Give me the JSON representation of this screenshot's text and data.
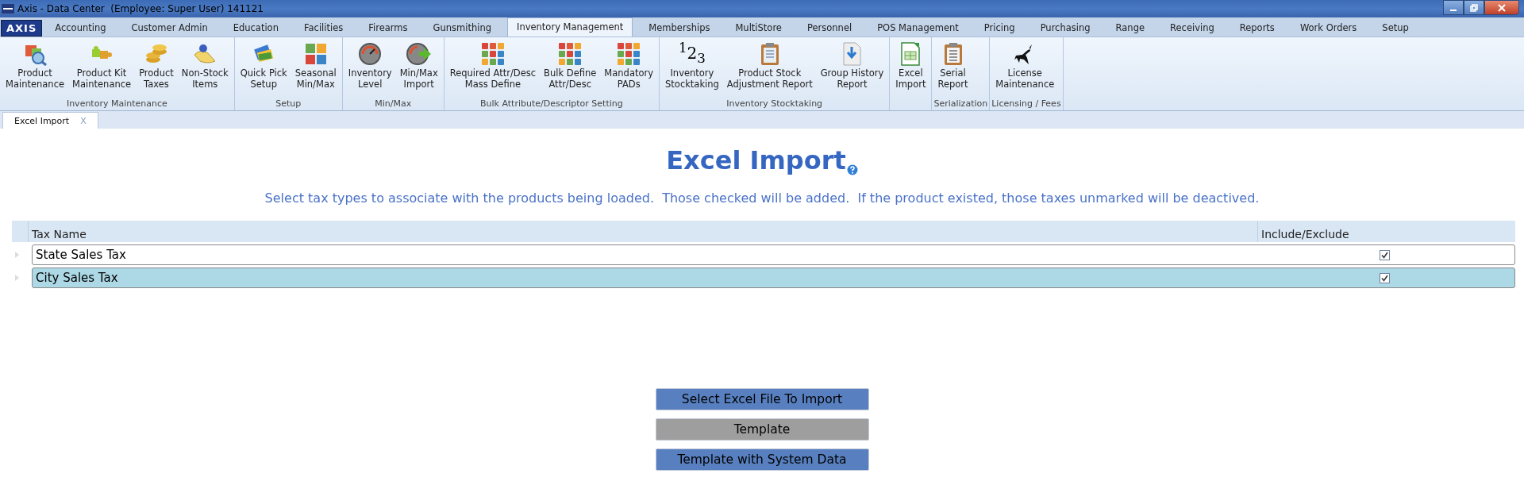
{
  "window": {
    "title": "Axis - Data Center  (Employee: Super User) 141121"
  },
  "menu_tabs": [
    {
      "label": "AXIS",
      "kind": "logo",
      "selected": false
    },
    {
      "label": "Accounting",
      "selected": false
    },
    {
      "label": "Customer Admin",
      "selected": false
    },
    {
      "label": "Education",
      "selected": false
    },
    {
      "label": "Facilities",
      "selected": false
    },
    {
      "label": "Firearms",
      "selected": false
    },
    {
      "label": "Gunsmithing",
      "selected": false
    },
    {
      "label": "Inventory Management",
      "selected": true
    },
    {
      "label": "Memberships",
      "selected": false
    },
    {
      "label": "MultiStore",
      "selected": false
    },
    {
      "label": "Personnel",
      "selected": false
    },
    {
      "label": "POS Management",
      "selected": false
    },
    {
      "label": "Pricing",
      "selected": false
    },
    {
      "label": "Purchasing",
      "selected": false
    },
    {
      "label": "Range",
      "selected": false
    },
    {
      "label": "Receiving",
      "selected": false
    },
    {
      "label": "Reports",
      "selected": false
    },
    {
      "label": "Work Orders",
      "selected": false
    },
    {
      "label": "Setup",
      "selected": false
    }
  ],
  "ribbon": {
    "groups": [
      {
        "title": "Inventory Maintenance",
        "items": [
          {
            "label": "Product\nMaintenance"
          },
          {
            "label": "Product Kit\nMaintenance"
          },
          {
            "label": "Product\nTaxes"
          },
          {
            "label": "Non-Stock\nItems"
          }
        ]
      },
      {
        "title": "Setup",
        "items": [
          {
            "label": "Quick Pick\nSetup"
          },
          {
            "label": "Seasonal\nMin/Max"
          }
        ]
      },
      {
        "title": "Min/Max",
        "items": [
          {
            "label": "Inventory\nLevel"
          },
          {
            "label": "Min/Max\nImport"
          }
        ]
      },
      {
        "title": "Bulk Attribute/Descriptor Setting",
        "items": [
          {
            "label": "Required Attr/Desc\nMass Define"
          },
          {
            "label": "Bulk Define\nAttr/Desc"
          },
          {
            "label": "Mandatory\nPADs"
          }
        ]
      },
      {
        "title": "Inventory Stocktaking",
        "items": [
          {
            "label": "Inventory\nStocktaking",
            "glyph": "$^{1}$2$_{3}$"
          },
          {
            "label": "Product Stock\nAdjustment Report"
          },
          {
            "label": "Group History\nReport"
          }
        ]
      },
      {
        "items": [
          {
            "label": "Excel\nImport"
          }
        ]
      },
      {
        "title": "Serialization",
        "items": [
          {
            "label": "Serial\nReport"
          }
        ]
      },
      {
        "title": "Licensing / Fees",
        "items": [
          {
            "label": "License\nMaintenance"
          }
        ]
      }
    ]
  },
  "doc_tabs": [
    {
      "label": "Excel Import",
      "close": "X",
      "selected": true
    }
  ],
  "page": {
    "heading": "Excel Import",
    "description": "Select tax types to associate with the products being loaded.  Those checked will be added.  If the product existed, those taxes unmarked will be deactived."
  },
  "table": {
    "columns": [
      "Tax Name",
      "Include/Exclude"
    ],
    "rows": [
      {
        "name": "State Sales Tax",
        "checked": true,
        "selected": false
      },
      {
        "name": "City Sales Tax",
        "checked": true,
        "selected": true
      }
    ]
  },
  "buttons": [
    {
      "label": "Select Excel File To Import",
      "disabled": false
    },
    {
      "label": "Template",
      "disabled": true
    },
    {
      "label": "Template with System Data",
      "disabled": false
    }
  ]
}
